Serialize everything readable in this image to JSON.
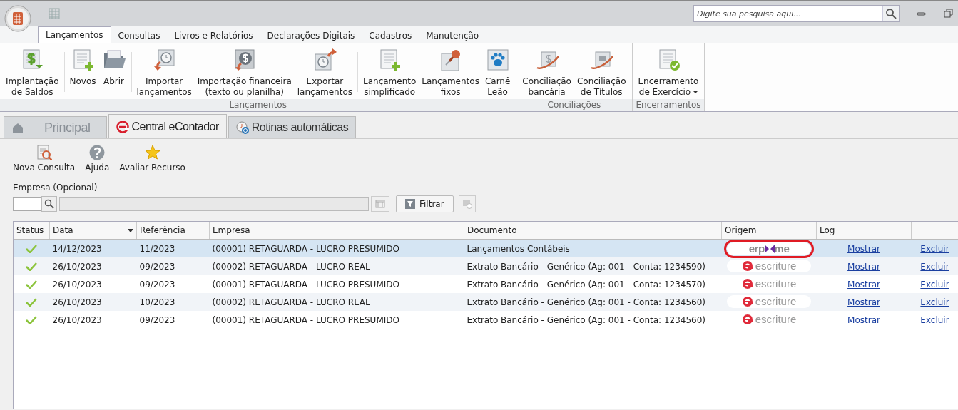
{
  "title_bar": {
    "search": {
      "placeholder": "Digite sua pesquisa aqui..."
    }
  },
  "ribbon_tabs": [
    {
      "label": "Lançamentos",
      "selected": true
    },
    {
      "label": "Consultas",
      "selected": false
    },
    {
      "label": "Livros e Relatórios",
      "selected": false
    },
    {
      "label": "Declarações Digitais",
      "selected": false
    },
    {
      "label": "Cadastros",
      "selected": false
    },
    {
      "label": "Manutenção",
      "selected": false
    }
  ],
  "ribbon_groups": [
    {
      "label": "Lançamentos",
      "buttons": [
        {
          "kind": "saldo",
          "lines": [
            "Implantação",
            "de Saldos"
          ],
          "sep_after": true
        },
        {
          "kind": "novo",
          "lines": [
            "Novos"
          ]
        },
        {
          "kind": "abrir",
          "lines": [
            "Abrir"
          ],
          "sep_after": true
        },
        {
          "kind": "importar",
          "lines": [
            "Importar",
            "lançamentos"
          ]
        },
        {
          "kind": "financeira",
          "lines": [
            "Importação financeira",
            "(texto ou planilha)"
          ]
        },
        {
          "kind": "exportar",
          "lines": [
            "Exportar",
            "lançamentos"
          ],
          "sep_after": true
        },
        {
          "kind": "novo",
          "lines": [
            "Lançamento",
            "simplificado"
          ]
        },
        {
          "kind": "fixo",
          "lines": [
            "Lançamentos",
            "fixos"
          ]
        },
        {
          "kind": "leao",
          "lines": [
            "Carnê",
            "Leão"
          ]
        }
      ]
    },
    {
      "label": "Conciliações",
      "buttons": [
        {
          "kind": "conc_banco",
          "lines": [
            "Conciliação",
            "bancária"
          ]
        },
        {
          "kind": "conc_titulo",
          "lines": [
            "Conciliação",
            "de Títulos"
          ]
        }
      ]
    },
    {
      "label": "Encerramentos",
      "buttons": [
        {
          "kind": "encerrar",
          "lines": [
            "Encerramento",
            "de Exercício"
          ],
          "dropdown": true
        }
      ]
    }
  ],
  "doc_tabs": [
    {
      "kind": "home",
      "label": "Principal",
      "selected": false
    },
    {
      "kind": "econtador",
      "label": "Central eContador",
      "selected": true
    },
    {
      "kind": "rotinas",
      "label": "Rotinas automáticas",
      "selected": false
    }
  ],
  "toolbar": [
    {
      "kind": "consulta",
      "label": "Nova Consulta"
    },
    {
      "kind": "ajuda",
      "label": "Ajuda"
    },
    {
      "kind": "estrela",
      "label": "Avaliar Recurso"
    }
  ],
  "filter": {
    "label": "Empresa (Opcional)",
    "button": "Filtrar"
  },
  "table": {
    "columns": [
      {
        "label": "Status",
        "sorted": false
      },
      {
        "label": "Data",
        "sorted": true
      },
      {
        "label": "Referência",
        "sorted": false
      },
      {
        "label": "Empresa",
        "sorted": false
      },
      {
        "label": "Documento",
        "sorted": false
      },
      {
        "label": "Origem",
        "sorted": false
      },
      {
        "label": "Log",
        "sorted": false
      },
      {
        "sorted": false
      }
    ],
    "rows": [
      {
        "selected": true,
        "ok": true,
        "data": "14/12/2023",
        "referencia": "11/2023",
        "empresa": "(00001) RETAGUARDA - LUCRO PRESUMIDO",
        "documento": "Lançamentos Contábeis",
        "origem": {
          "kind": "erpme",
          "parts": [
            "erp",
            "me"
          ],
          "highlighted": true
        },
        "log": "Mostrar",
        "action": "Excluir"
      },
      {
        "selected": false,
        "ok": true,
        "data": "26/10/2023",
        "referencia": "09/2023",
        "empresa": "(00002) RETAGUARDA - LUCRO REAL",
        "documento": "Extrato Bancário - Genérico (Ag: 001 - Conta: 1234590)",
        "origem": {
          "kind": "escriture",
          "parts": [
            "escriture"
          ],
          "highlighted": false
        },
        "log": "Mostrar",
        "action": "Excluir"
      },
      {
        "selected": false,
        "ok": true,
        "data": "26/10/2023",
        "referencia": "09/2023",
        "empresa": "(00001) RETAGUARDA - LUCRO PRESUMIDO",
        "documento": "Extrato Bancário - Genérico (Ag: 001 - Conta: 1234570)",
        "origem": {
          "kind": "escriture",
          "parts": [
            "escriture"
          ],
          "highlighted": false
        },
        "log": "Mostrar",
        "action": "Excluir"
      },
      {
        "selected": false,
        "ok": true,
        "data": "26/10/2023",
        "referencia": "10/2023",
        "empresa": "(00002) RETAGUARDA - LUCRO REAL",
        "documento": "Extrato Bancário - Genérico (Ag: 001 - Conta: 1234560)",
        "origem": {
          "kind": "escriture",
          "parts": [
            "escriture"
          ],
          "highlighted": false
        },
        "log": "Mostrar",
        "action": "Excluir"
      },
      {
        "selected": false,
        "ok": true,
        "data": "26/10/2023",
        "referencia": "09/2023",
        "empresa": "(00001) RETAGUARDA - LUCRO PRESUMIDO",
        "documento": "Extrato Bancário - Genérico (Ag: 001 - Conta: 1234560)",
        "origem": {
          "kind": "escriture",
          "parts": [
            "escriture"
          ],
          "highlighted": false
        },
        "log": "Mostrar",
        "action": "Excluir"
      }
    ]
  }
}
